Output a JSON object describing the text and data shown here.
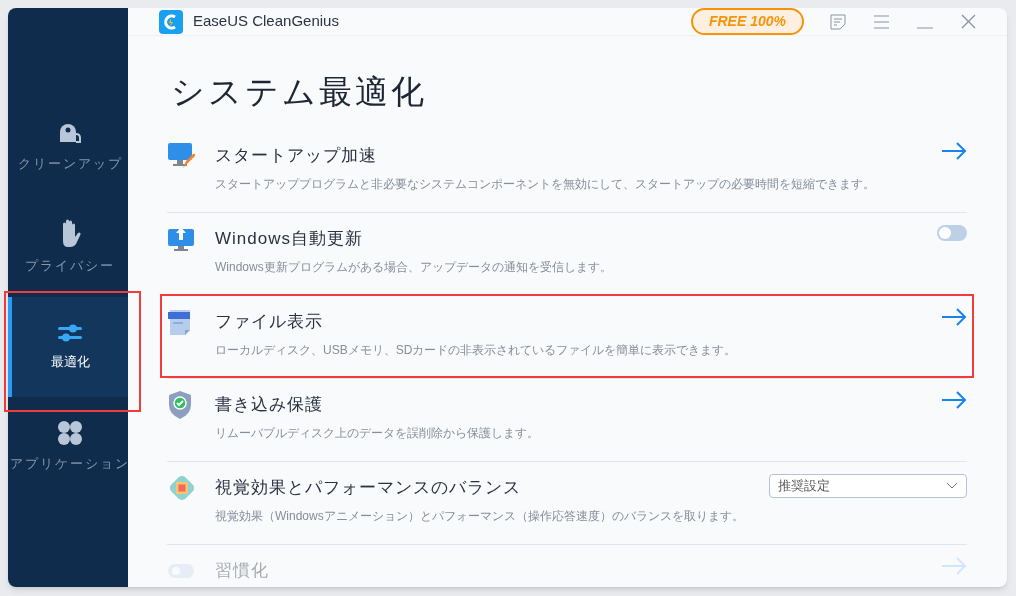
{
  "window": {
    "title": "EaseUS CleanGenius",
    "badge": "FREE 100%"
  },
  "sidebar": {
    "items": [
      {
        "kind": "cleanup",
        "label": "クリーンアップ",
        "selected": false
      },
      {
        "kind": "privacy",
        "label": "プライバシー",
        "selected": false
      },
      {
        "kind": "optimize",
        "label": "最適化",
        "selected": true
      },
      {
        "kind": "apps",
        "label": "アプリケーション",
        "selected": false
      }
    ]
  },
  "heading": "システム最適化",
  "rows": [
    {
      "kind": "startup",
      "title": "スタートアップ加速",
      "description": "スタートアッププログラムと非必要なシステムコンポーネントを無効にして、スタートアップの必要時間を短縮できます。",
      "control": {
        "kind": "arrow"
      },
      "highlighted": false,
      "faded": false
    },
    {
      "kind": "update",
      "title": "Windows自動更新",
      "description": "Windows更新プログラムがある場合、アップデータの通知を受信します。",
      "control": {
        "kind": "toggle",
        "on": false
      },
      "highlighted": false,
      "faded": false
    },
    {
      "kind": "file",
      "title": "ファイル表示",
      "description": "ローカルディスク、USBメモリ、SDカードの非表示されているファイルを簡単に表示できます。",
      "control": {
        "kind": "arrow"
      },
      "highlighted": true,
      "faded": false
    },
    {
      "kind": "shield",
      "title": "書き込み保護",
      "description": "リムーバブルディスク上のデータを誤削除から保護します。",
      "control": {
        "kind": "arrow"
      },
      "highlighted": false,
      "faded": false
    },
    {
      "kind": "chip",
      "title": "視覚効果とパフォーマンスのバランス",
      "description": "視覚効果（Windowsアニメーション）とパフォーマンス（操作応答速度）のバランスを取ります。",
      "control": {
        "kind": "select",
        "value": "推奨設定"
      },
      "highlighted": false,
      "faded": false
    },
    {
      "kind": "habit",
      "title": "習慣化",
      "control": {
        "kind": "arrow"
      },
      "highlighted": false,
      "faded": true
    }
  ]
}
